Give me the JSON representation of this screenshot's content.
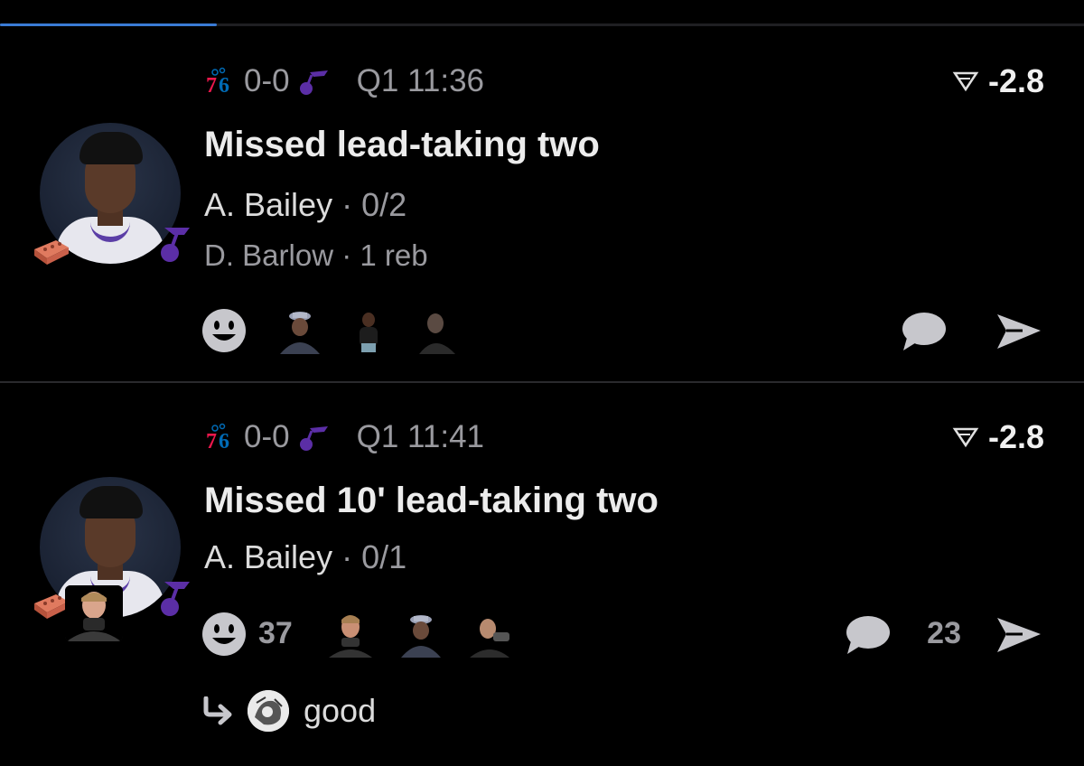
{
  "progress": {
    "fraction": 0.2,
    "color": "#3a7bd5"
  },
  "cards": [
    {
      "home_team_icon": "76ers-logo-icon",
      "score": "0-0",
      "away_team_icon": "jazz-logo-icon",
      "clock": "Q1 11:36",
      "win_prob_icon": "win-probability-icon",
      "win_prob_delta": "-2.8",
      "title": "Missed lead-taking two",
      "shooter_name": "A. Bailey",
      "shooter_stat": "0/2",
      "rebounder_name": "D. Barlow",
      "rebounder_stat": "1 reb",
      "separator": "·",
      "reactions": [
        "smiley-add-icon",
        "reaction-gif-icon",
        "reaction-gif-icon",
        "reaction-gif-icon"
      ],
      "comment_icon": "comment-bubble-icon",
      "share_icon": "send-icon"
    },
    {
      "home_team_icon": "76ers-logo-icon",
      "score": "0-0",
      "away_team_icon": "jazz-logo-icon",
      "clock": "Q1 11:41",
      "win_prob_icon": "win-probability-icon",
      "win_prob_delta": "-2.8",
      "title": "Missed 10' lead-taking two",
      "shooter_name": "A. Bailey",
      "shooter_stat": "0/1",
      "separator": "·",
      "reaction_count": "37",
      "comment_count": "23",
      "reply_text": "good"
    }
  ],
  "colors": {
    "background": "#000000",
    "muted": "#9a9a9f",
    "brick": "#d9534f",
    "jazz_purple": "#5b2ea6",
    "sixers_red": "#ed174c",
    "sixers_blue": "#006bb6"
  }
}
